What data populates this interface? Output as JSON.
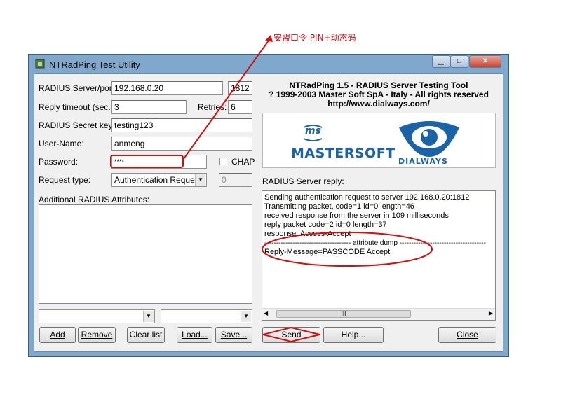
{
  "annotation": {
    "note": "安盟口令  PIN+动态码"
  },
  "window": {
    "title": "NTRadPing Test Utility"
  },
  "form": {
    "server_label": "RADIUS Server/port:",
    "server_value": "192.168.0.20",
    "port_value": "1812",
    "timeout_label": "Reply timeout (sec.):",
    "timeout_value": "3",
    "retries_label": "Retries:",
    "retries_value": "6",
    "secret_label": "RADIUS Secret key:",
    "secret_value": "testing123",
    "username_label": "User-Name:",
    "username_value": "anmeng",
    "password_label": "Password:",
    "password_value": "****",
    "chap_label": "CHAP",
    "request_type_label": "Request type:",
    "request_type_value": "Authentication Request",
    "request_id_value": "0",
    "additional_label": "Additional RADIUS Attributes:"
  },
  "buttons": {
    "add": "Add",
    "remove": "Remove",
    "clear": "Clear list",
    "load": "Load...",
    "save": "Save...",
    "send": "Send",
    "help": "Help...",
    "close": "Close"
  },
  "about": {
    "line1": "NTRadPing 1.5 - RADIUS Server Testing Tool",
    "line2": "? 1999-2003 Master Soft SpA - Italy - All rights reserved",
    "line3": "http://www.dialways.com/"
  },
  "logos": {
    "mastersoft_badge": "ms",
    "mastersoft": "MASTERSOFT",
    "dialways": "DIALWAYS"
  },
  "reply": {
    "label": "RADIUS Server reply:",
    "lines": [
      "Sending authentication request to server 192.168.0.20:1812",
      "Transmitting packet, code=1 id=0 length=46",
      "received response from the server in 109 milliseconds",
      "reply packet code=2 id=0 length=37",
      "response: Access-Accept",
      "------------------------------------- attribute dump -------------------------------------",
      "Reply-Message=PASSCODE Accept"
    ],
    "scroll_mark": "III"
  },
  "colors": {
    "annotation": "#cc1111",
    "window_frame": "#7fa8cc",
    "logo_blue": "#1b63a8"
  }
}
